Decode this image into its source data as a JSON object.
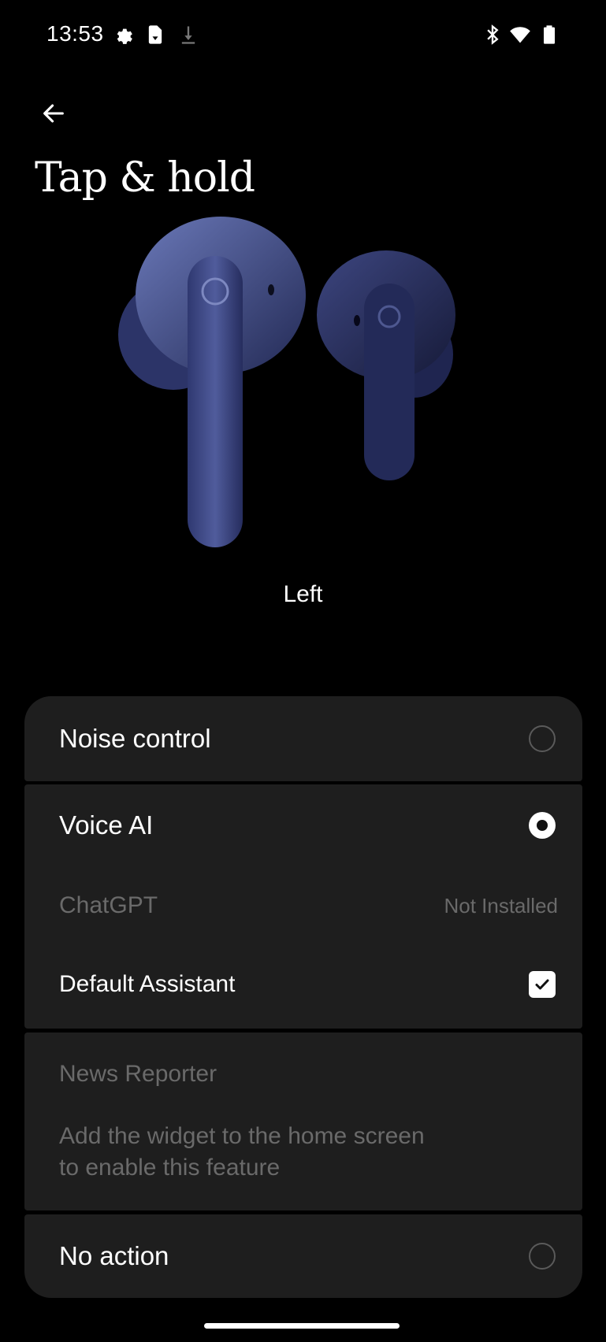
{
  "status_bar": {
    "time": "13:53",
    "left_icons": [
      "settings-gear-icon",
      "download-file-icon",
      "download-arrow-icon"
    ],
    "right_icons": [
      "bluetooth-icon",
      "wifi-icon",
      "battery-icon"
    ]
  },
  "header": {
    "title": "Tap & hold"
  },
  "device": {
    "selected_side": "Left",
    "image": "earbuds-image"
  },
  "options": {
    "noise_control": {
      "label": "Noise control",
      "selected": false
    },
    "voice_ai": {
      "label": "Voice AI",
      "selected": true
    },
    "chatgpt": {
      "label": "ChatGPT",
      "status": "Not Installed"
    },
    "default_assistant": {
      "label": "Default Assistant",
      "checked": true
    },
    "news_reporter": {
      "label": "News Reporter",
      "hint": "Add the widget to the home screen to enable this feature"
    },
    "no_action": {
      "label": "No action",
      "selected": false
    }
  },
  "colors": {
    "card": "#1e1e1e",
    "disabled_text": "#6a6a6a",
    "background": "#000000"
  }
}
